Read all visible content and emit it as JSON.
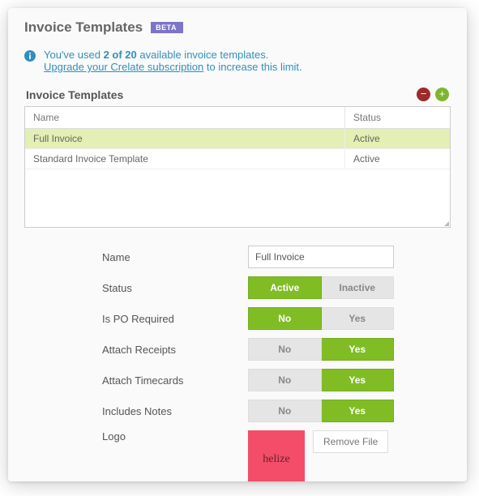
{
  "page": {
    "title": "Invoice Templates",
    "beta_badge": "BETA"
  },
  "notice": {
    "prefix": "You've used ",
    "used_count": "2 of 20",
    "mid": " available invoice templates.",
    "link_text": "Upgrade your Crelate subscription",
    "suffix": " to increase this limit."
  },
  "panel": {
    "title": "Invoice Templates"
  },
  "table": {
    "columns": {
      "name": "Name",
      "status": "Status"
    },
    "rows": [
      {
        "name": "Full Invoice",
        "status": "Active",
        "selected": true
      },
      {
        "name": "Standard Invoice Template",
        "status": "Active",
        "selected": false
      }
    ]
  },
  "form": {
    "labels": {
      "name": "Name",
      "status": "Status",
      "po_required": "Is PO Required",
      "attach_receipts": "Attach Receipts",
      "attach_timecards": "Attach Timecards",
      "includes_notes": "Includes Notes",
      "logo": "Logo"
    },
    "values": {
      "name": "Full Invoice"
    },
    "options": {
      "status": {
        "active": "Active",
        "inactive": "Inactive",
        "selected": "active"
      },
      "po_required": {
        "no": "No",
        "yes": "Yes",
        "selected": "no"
      },
      "attach_receipts": {
        "no": "No",
        "yes": "Yes",
        "selected": "yes"
      },
      "attach_timecards": {
        "no": "No",
        "yes": "Yes",
        "selected": "yes"
      },
      "includes_notes": {
        "no": "No",
        "yes": "Yes",
        "selected": "yes"
      }
    },
    "logo": {
      "text": "helize",
      "remove_label": "Remove File"
    }
  }
}
